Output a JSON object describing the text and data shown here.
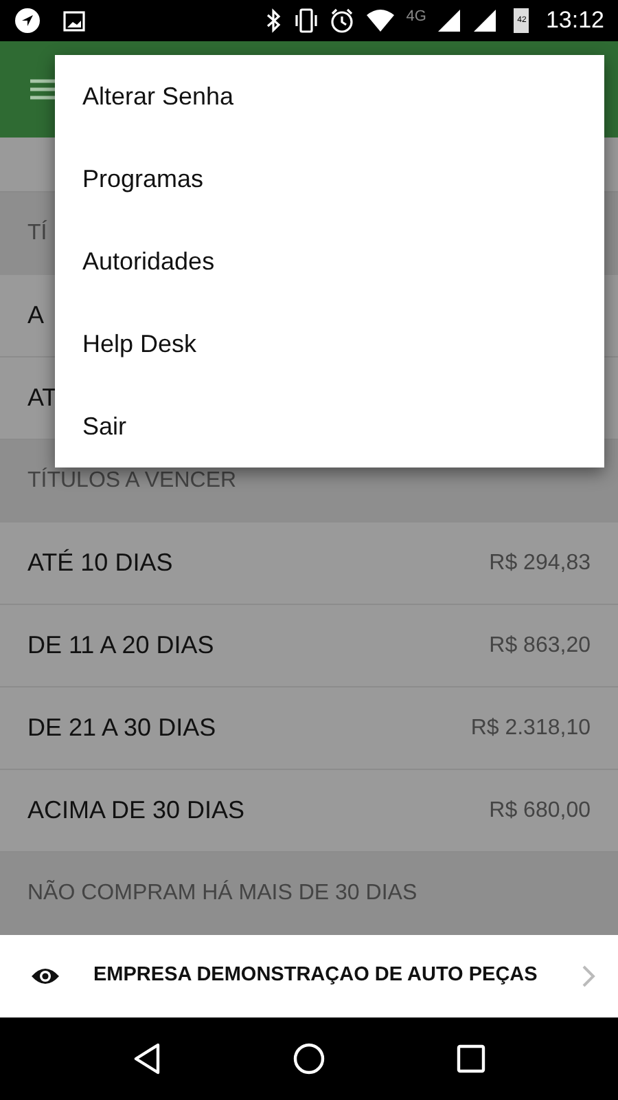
{
  "status_bar": {
    "time": "13:12",
    "network": "4G",
    "battery": "42"
  },
  "sections": [
    {
      "title": "TÍ",
      "rows": [
        {
          "label": "A"
        },
        {
          "label": "AT"
        }
      ]
    },
    {
      "title": "TÍTULOS A VENCER",
      "rows": [
        {
          "label": "ATÉ 10 DIAS",
          "amount": "R$ 294,83"
        },
        {
          "label": "DE 11 A 20 DIAS",
          "amount": "R$ 863,20"
        },
        {
          "label": "DE 21 A 30 DIAS",
          "amount": "R$ 2.318,10"
        },
        {
          "label": "ACIMA DE 30 DIAS",
          "amount": "R$ 680,00"
        }
      ]
    },
    {
      "title": "NÃO COMPRAM HÁ MAIS DE 30 DIAS"
    }
  ],
  "menu": [
    {
      "label": "Alterar Senha"
    },
    {
      "label": "Programas"
    },
    {
      "label": "Autoridades"
    },
    {
      "label": "Help Desk"
    },
    {
      "label": "Sair"
    }
  ],
  "footer": {
    "company": "EMPRESA DEMONSTRAÇAO DE AUTO PEÇAS"
  }
}
